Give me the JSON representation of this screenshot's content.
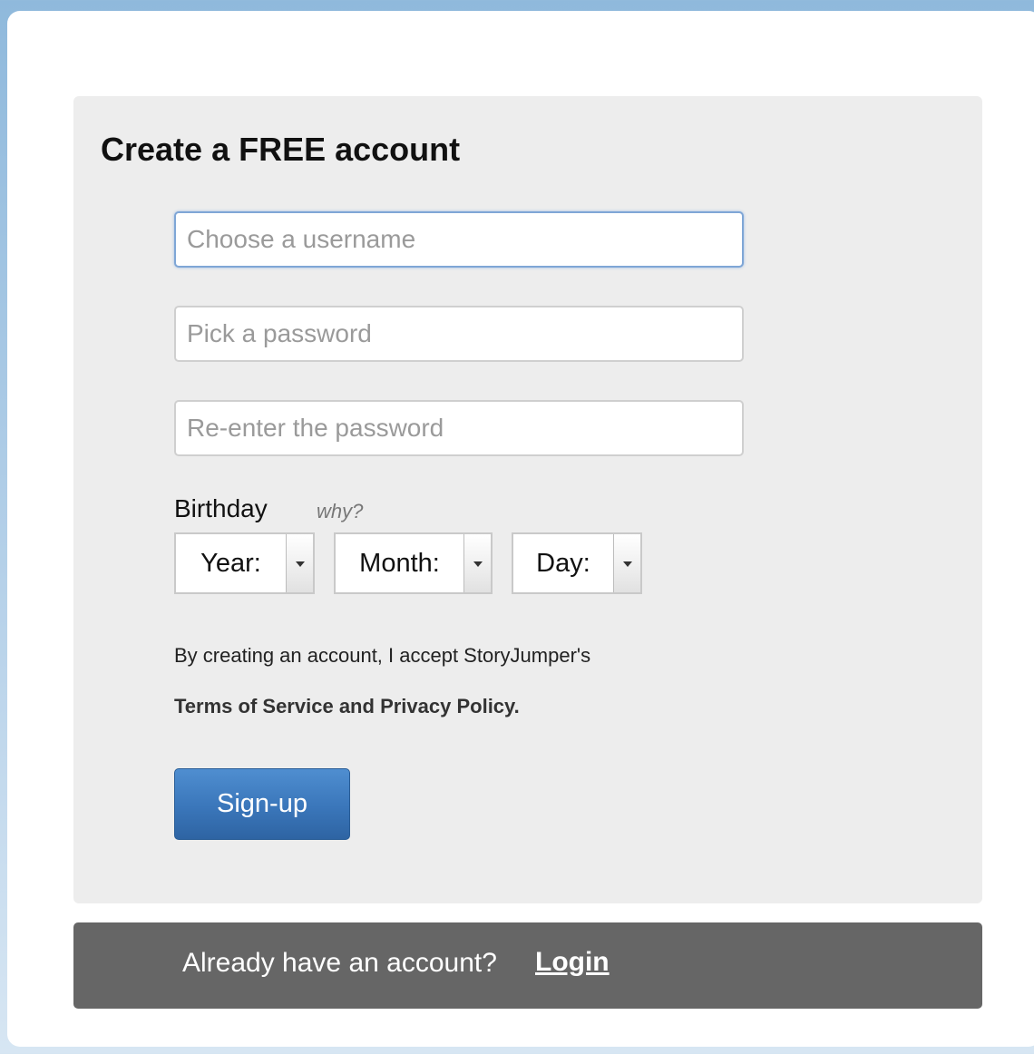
{
  "form": {
    "title": "Create a FREE account",
    "username_placeholder": "Choose a username",
    "password_placeholder": "Pick a password",
    "password_confirm_placeholder": "Re-enter the password",
    "birthday_label": "Birthday",
    "why_link": "why?",
    "selects": {
      "year": "Year:",
      "month": "Month:",
      "day": "Day:"
    },
    "terms": {
      "line1": "By creating an account, I accept StoryJumper's",
      "terms_link": "Terms of Service",
      "and": "and",
      "privacy_link": "Privacy Policy."
    },
    "submit_label": "Sign-up"
  },
  "login_bar": {
    "prompt": "Already have an account?",
    "login_link": "Login"
  },
  "colors": {
    "accent": "#3a76ba",
    "panel_bg": "#ededed",
    "login_bar_bg": "#666666"
  }
}
